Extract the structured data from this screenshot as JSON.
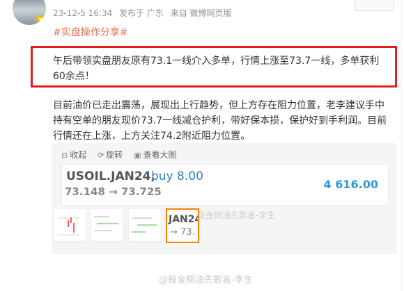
{
  "post": {
    "timestamp": "23-12-5 16:34",
    "location": "发布于 广东",
    "source": "来自 微博网页版",
    "topic": "#实盘操作分享#",
    "paragraph1": "午后带领实盘朋友原有73.1一线介入多单，行情上涨至73.7一线，多单获利60余点！",
    "paragraph2": "目前油价已走出震荡，展现出上行趋势，但上方存在阻力位置，老李建议手中持有空单的朋友现价73.7一线减仓护利，带好保本损，保护好到手利润。目前行情还在上涨，上方关注74.2附近阻力位置。"
  },
  "media": {
    "toolbar": {
      "collapse_label": "收起",
      "rotate_label": "旋转",
      "view_large_label": "查看大图"
    },
    "quote": {
      "symbol": "USOIL.JAN24,",
      "side": "buy 8.00",
      "prices": "73.148 → 73.725",
      "pnl": "4 616.00",
      "watermark": "@投金期油先歌者-李生"
    },
    "thumbnails": [
      {
        "name": "chart-thumbnail"
      },
      {
        "name": "chat-thumbnail-1"
      },
      {
        "name": "chat-thumbnail-2"
      },
      {
        "name": "quote-thumbnail",
        "symbol": "JAN24,",
        "arrow": "→ 73."
      }
    ]
  },
  "footer": {
    "watermark": "@投金期油先歌者-李生"
  },
  "colors": {
    "highlight_border": "#e41d1d",
    "topic": "#eb7350",
    "side": "#2f7fc6",
    "pnl": "#2f9ad6",
    "selected_thumb": "#ff8200"
  }
}
